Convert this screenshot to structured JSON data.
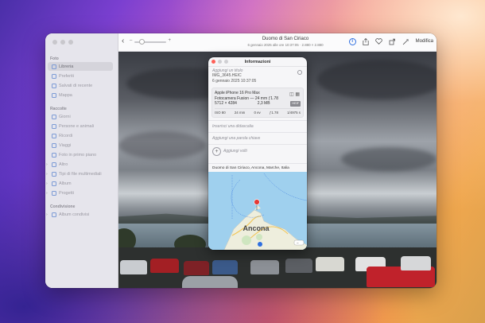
{
  "sidebar": {
    "sections": [
      {
        "title": "Foto",
        "items": [
          {
            "label": "Libreria",
            "selected": true
          },
          {
            "label": "Preferiti"
          },
          {
            "label": "Salvati di recente"
          },
          {
            "label": "Mappa"
          }
        ]
      },
      {
        "title": "Raccolte",
        "items": [
          {
            "label": "Giorni"
          },
          {
            "label": "Persone e animali"
          },
          {
            "label": "Ricordi"
          },
          {
            "label": "Viaggi"
          },
          {
            "label": "Foto in primo piano"
          },
          {
            "label": "Altro",
            "expandable": true
          },
          {
            "label": "Tipi di file multimediali",
            "expandable": true
          },
          {
            "label": "Album",
            "expandable": true
          },
          {
            "label": "Progetti",
            "expandable": true
          }
        ]
      },
      {
        "title": "Condivisione",
        "items": [
          {
            "label": "Album condivisi"
          }
        ]
      }
    ]
  },
  "toolbar": {
    "title": "Duomo di San Ciriaco",
    "subtitle": "6 gennaio 2025 alle ore 10:37:05  ·  2.880 × 2.880",
    "edit_label": "Modifica",
    "icons": [
      "info-icon",
      "share-icon",
      "heart-icon",
      "rotate-icon",
      "magic-wand-icon"
    ]
  },
  "info_panel": {
    "title": "Informazioni",
    "caption_placeholder": "Aggiungi un titolo",
    "filename": "IMG_3645.HEIC",
    "datetime": "6 gennaio 2025    10:37:05",
    "camera": {
      "model": "Apple iPhone 16 Pro Max",
      "lens": "Fotocamera Fusion — 24 mm ƒ1.78",
      "resolution": "5712 × 4284",
      "size": "2,3 MB",
      "format_badge": "HEIF",
      "exif": [
        "ISO 80",
        "24 mm",
        "0 ev",
        "ƒ1.78",
        "1/4975 s"
      ]
    },
    "description_placeholder": "Inserisci una didascalia",
    "keyword_placeholder": "Aggiungi una parola chiave",
    "faces_label": "Aggiungi volti",
    "location": "Duomo di San Ciriaco, Ancona, Marche, Italia",
    "map": {
      "city_label": "Ancona",
      "pin_color": "#e53935",
      "water_color": "#9fd0ee",
      "land_color": "#f0eee6"
    }
  },
  "colors": {
    "accent": "#2f6fe0",
    "close": "#fe5f57"
  }
}
